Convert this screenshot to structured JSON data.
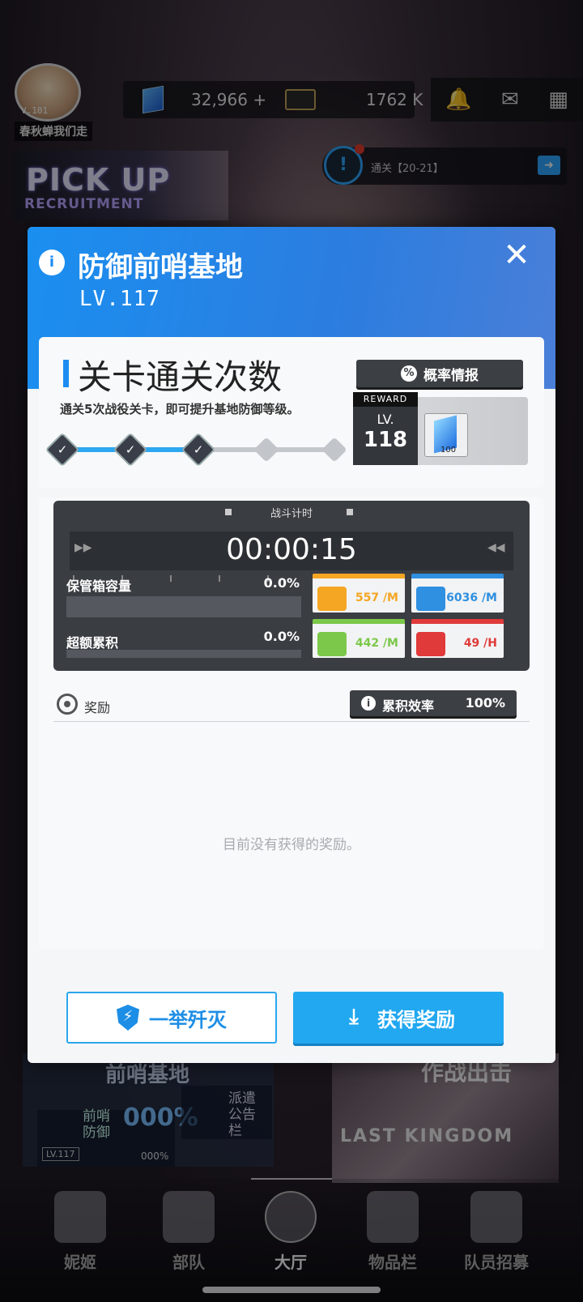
{
  "topbar": {
    "avatar_level": "V.101",
    "player_name": "春秋蝉我们走",
    "gems": "32,966",
    "gems_add": "+",
    "credits": "1762 K",
    "icons": [
      "bell-icon",
      "mail-icon",
      "grid-menu-icon"
    ]
  },
  "banner": {
    "pickup_title": "PICK UP",
    "pickup_sub": "RECRUITMENT"
  },
  "notice": {
    "icon": "!",
    "text": "通关【20-21】",
    "arrow": "➜"
  },
  "modal": {
    "title": "防御前哨基地",
    "level": "LV.117",
    "close": "✕",
    "clear_section": {
      "title": "关卡通关次数",
      "prob_button": "概率情报",
      "prob_icon": "%",
      "description": "通关5次战役关卡，即可提升基地防御等级。",
      "progress_done": 3,
      "progress_total": 5,
      "reward": {
        "tag": "REWARD",
        "lv_label": "LV.",
        "lv_value": "118",
        "item_qty": "100"
      }
    },
    "battle": {
      "timer_label": "战斗计时",
      "timer_value": "00:00:15",
      "ff_left": "▶▶",
      "ff_right": "◀◀",
      "stash_label": "保管箱容量",
      "stash_pct": "0.0%",
      "overflow_label": "超额累积",
      "overflow_pct": "0.0%",
      "resources": [
        {
          "name": "credit",
          "value": "557 /M",
          "color": "#f5a623"
        },
        {
          "name": "battle-data",
          "value": "6036 /M",
          "color": "#2f8fe0"
        },
        {
          "name": "core-dust",
          "value": "442 /M",
          "color": "#7cc84a"
        },
        {
          "name": "exp-chip",
          "value": "49 /H",
          "color": "#e03a3a"
        }
      ]
    },
    "rewards": {
      "label": "奖励",
      "efficiency_label": "累积效率",
      "efficiency_value": "100%",
      "empty_text": "目前没有获得的奖励。"
    },
    "buttons": {
      "annihilate": "一举歼灭",
      "claim": "获得奖励"
    }
  },
  "scene": {
    "outpost_title": "前哨基地",
    "outpost_label": "前哨防御",
    "outpost_pct": "000%",
    "outpost_lv": "LV.117",
    "outpost_bar_pct": "000%",
    "dispatch_label": "派遣公告栏",
    "battle_title": "作战出击",
    "kingdom": "LAST KINGDOM"
  },
  "nav": {
    "items": [
      {
        "label": "妮姬",
        "icon": "nikke-icon"
      },
      {
        "label": "部队",
        "icon": "squad-icon"
      },
      {
        "label": "大厅",
        "icon": "lobby-icon"
      },
      {
        "label": "物品栏",
        "icon": "inventory-icon"
      },
      {
        "label": "队员招募",
        "icon": "recruit-icon"
      }
    ],
    "active": 2
  }
}
